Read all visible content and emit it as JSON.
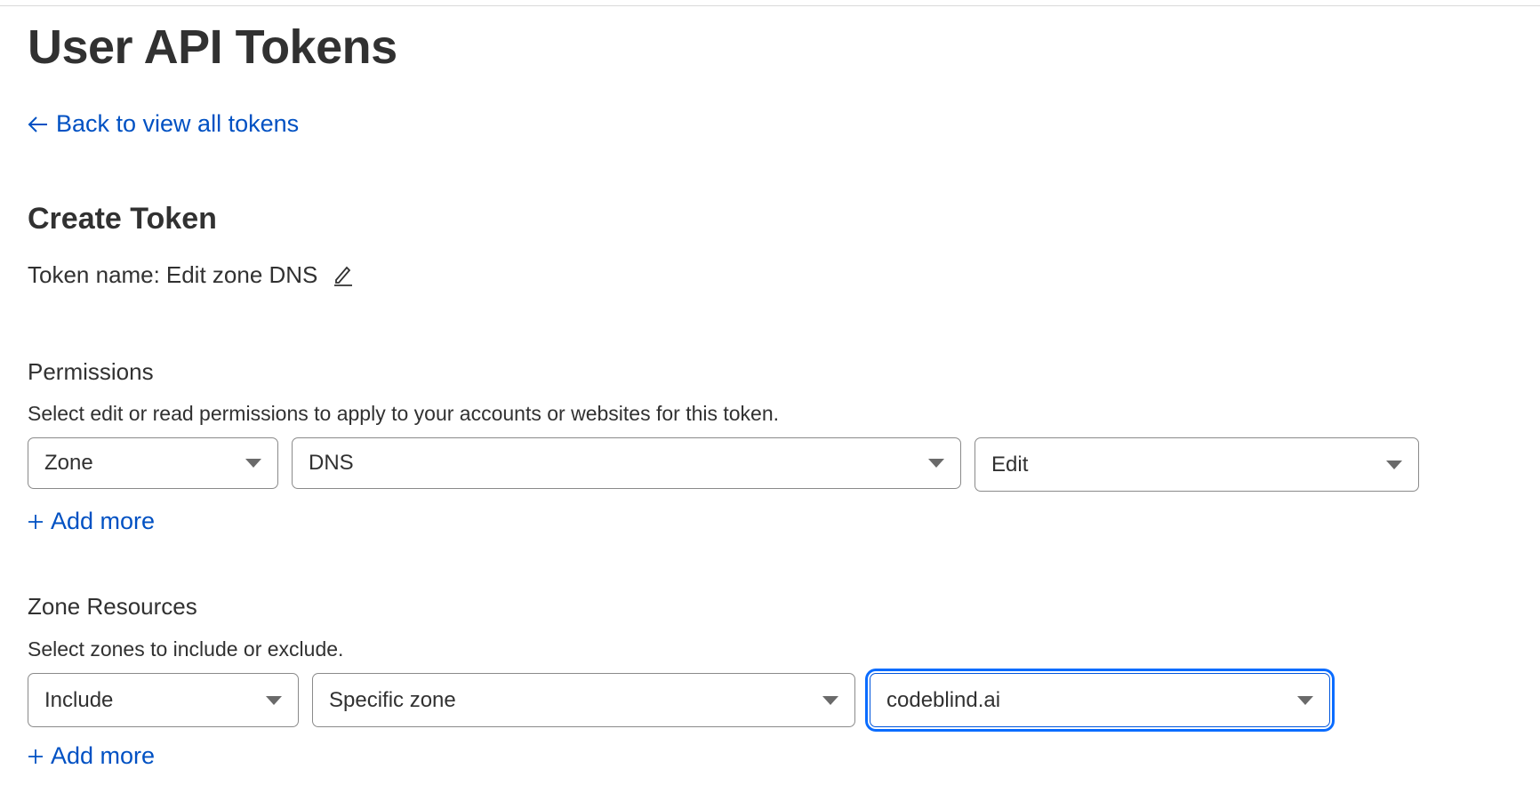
{
  "page": {
    "title": "User API Tokens",
    "back_link": "Back to view all tokens"
  },
  "create": {
    "heading": "Create Token",
    "token_name_label": "Token name:",
    "token_name_value": "Edit zone DNS"
  },
  "permissions": {
    "heading": "Permissions",
    "description": "Select edit or read permissions to apply to your accounts or websites for this token.",
    "selects": [
      "Zone",
      "DNS",
      "Edit"
    ],
    "add_more": "Add more"
  },
  "zone_resources": {
    "heading": "Zone Resources",
    "description": "Select zones to include or exclude.",
    "selects": [
      "Include",
      "Specific zone",
      "codeblind.ai"
    ],
    "add_more": "Add more"
  },
  "colors": {
    "link": "#0051c3",
    "focus": "#0a6cff",
    "text": "#313131"
  }
}
